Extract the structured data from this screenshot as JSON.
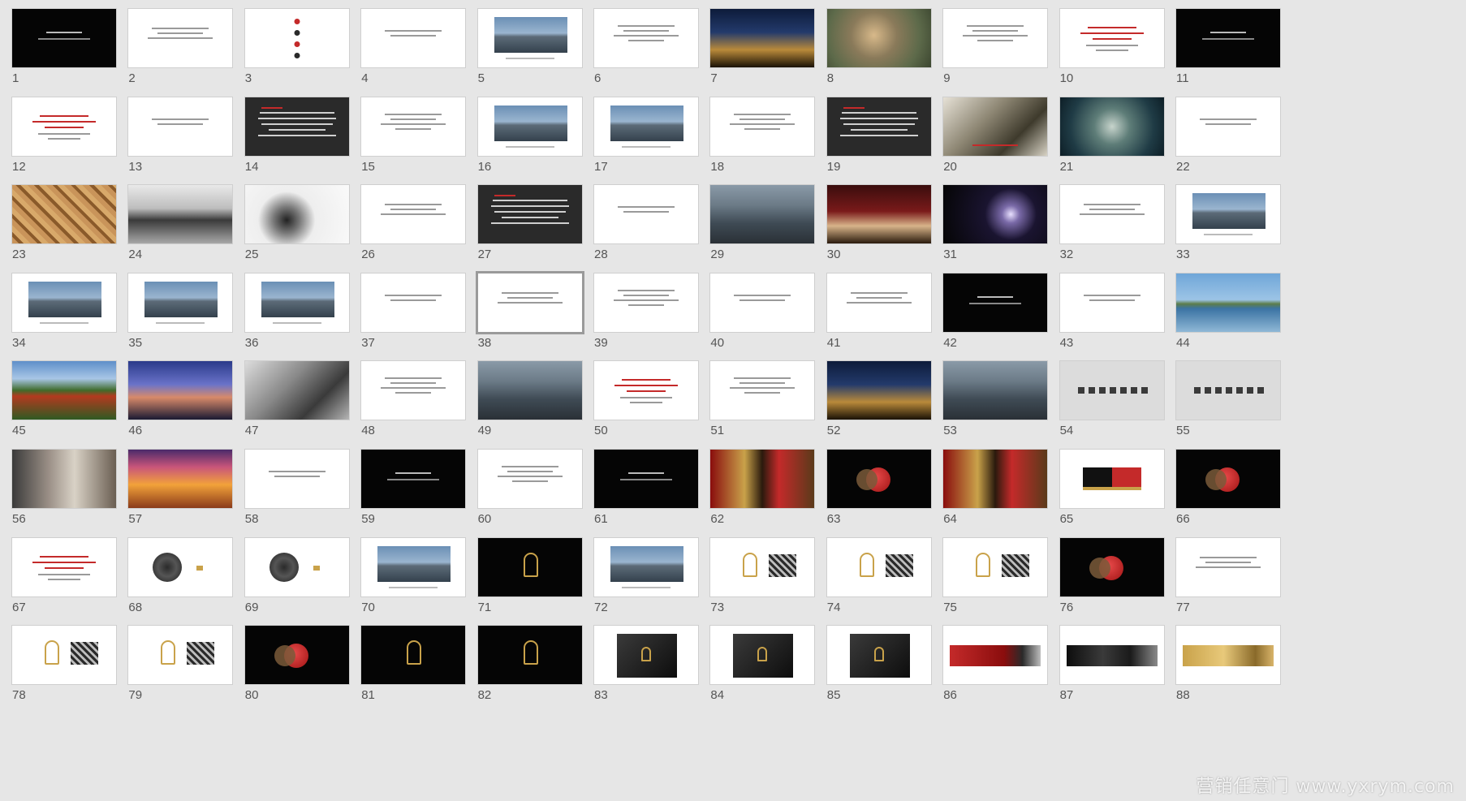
{
  "window": {
    "background": "#e6e6e6"
  },
  "slides": [
    {
      "n": "1",
      "kind": "black-text"
    },
    {
      "n": "2",
      "kind": "white-lines"
    },
    {
      "n": "3",
      "kind": "white-dots"
    },
    {
      "n": "4",
      "kind": "white-lines"
    },
    {
      "n": "5",
      "kind": "white-photo"
    },
    {
      "n": "6",
      "kind": "white-lines"
    },
    {
      "n": "7",
      "kind": "photo-night"
    },
    {
      "n": "8",
      "kind": "photo-portrait"
    },
    {
      "n": "9",
      "kind": "white-lines"
    },
    {
      "n": "10",
      "kind": "white-red"
    },
    {
      "n": "11",
      "kind": "black-text"
    },
    {
      "n": "12",
      "kind": "white-red"
    },
    {
      "n": "13",
      "kind": "white-lines"
    },
    {
      "n": "14",
      "kind": "dark-text"
    },
    {
      "n": "15",
      "kind": "white-lines"
    },
    {
      "n": "16",
      "kind": "white-photo"
    },
    {
      "n": "17",
      "kind": "white-photo"
    },
    {
      "n": "18",
      "kind": "white-lines"
    },
    {
      "n": "19",
      "kind": "dark-text"
    },
    {
      "n": "20",
      "kind": "photo-bronze"
    },
    {
      "n": "21",
      "kind": "photo-teal"
    },
    {
      "n": "22",
      "kind": "white-lines"
    },
    {
      "n": "23",
      "kind": "photo-pattern"
    },
    {
      "n": "24",
      "kind": "photo-bells"
    },
    {
      "n": "25",
      "kind": "photo-ink"
    },
    {
      "n": "26",
      "kind": "white-lines"
    },
    {
      "n": "27",
      "kind": "dark-text"
    },
    {
      "n": "28",
      "kind": "white-lines"
    },
    {
      "n": "29",
      "kind": "photo-city"
    },
    {
      "n": "30",
      "kind": "photo-stage"
    },
    {
      "n": "31",
      "kind": "photo-dark"
    },
    {
      "n": "32",
      "kind": "white-lines"
    },
    {
      "n": "33",
      "kind": "white-photo"
    },
    {
      "n": "34",
      "kind": "white-photo"
    },
    {
      "n": "35",
      "kind": "white-photo"
    },
    {
      "n": "36",
      "kind": "white-photo"
    },
    {
      "n": "37",
      "kind": "white-lines"
    },
    {
      "n": "38",
      "kind": "white-lines",
      "selected": true
    },
    {
      "n": "39",
      "kind": "white-lines"
    },
    {
      "n": "40",
      "kind": "white-lines"
    },
    {
      "n": "41",
      "kind": "white-lines"
    },
    {
      "n": "42",
      "kind": "black-text"
    },
    {
      "n": "43",
      "kind": "white-lines"
    },
    {
      "n": "44",
      "kind": "photo-lake"
    },
    {
      "n": "45",
      "kind": "photo-wall"
    },
    {
      "n": "46",
      "kind": "photo-dusk"
    },
    {
      "n": "47",
      "kind": "photo-grey"
    },
    {
      "n": "48",
      "kind": "white-lines"
    },
    {
      "n": "49",
      "kind": "photo-city"
    },
    {
      "n": "50",
      "kind": "white-red"
    },
    {
      "n": "51",
      "kind": "white-lines"
    },
    {
      "n": "52",
      "kind": "photo-night"
    },
    {
      "n": "53",
      "kind": "photo-city"
    },
    {
      "n": "54",
      "kind": "grey-icons"
    },
    {
      "n": "55",
      "kind": "grey-icons"
    },
    {
      "n": "56",
      "kind": "photo-interior"
    },
    {
      "n": "57",
      "kind": "photo-sunset"
    },
    {
      "n": "58",
      "kind": "white-lines"
    },
    {
      "n": "59",
      "kind": "black-text"
    },
    {
      "n": "60",
      "kind": "white-lines"
    },
    {
      "n": "61",
      "kind": "black-text"
    },
    {
      "n": "62",
      "kind": "red-collage"
    },
    {
      "n": "63",
      "kind": "black-red"
    },
    {
      "n": "64",
      "kind": "red-collage"
    },
    {
      "n": "65",
      "kind": "white-band"
    },
    {
      "n": "66",
      "kind": "black-red"
    },
    {
      "n": "67",
      "kind": "white-red"
    },
    {
      "n": "68",
      "kind": "white-disc"
    },
    {
      "n": "69",
      "kind": "white-disc"
    },
    {
      "n": "70",
      "kind": "white-photo"
    },
    {
      "n": "71",
      "kind": "black-gold"
    },
    {
      "n": "72",
      "kind": "white-photo"
    },
    {
      "n": "73",
      "kind": "white-gold"
    },
    {
      "n": "74",
      "kind": "white-gold"
    },
    {
      "n": "75",
      "kind": "white-gold"
    },
    {
      "n": "76",
      "kind": "black-red"
    },
    {
      "n": "77",
      "kind": "white-lines"
    },
    {
      "n": "78",
      "kind": "white-gold"
    },
    {
      "n": "79",
      "kind": "white-gold"
    },
    {
      "n": "80",
      "kind": "black-red"
    },
    {
      "n": "81",
      "kind": "black-gold"
    },
    {
      "n": "82",
      "kind": "black-gold"
    },
    {
      "n": "83",
      "kind": "white-card"
    },
    {
      "n": "84",
      "kind": "white-card"
    },
    {
      "n": "85",
      "kind": "white-card"
    },
    {
      "n": "86",
      "kind": "white-redband"
    },
    {
      "n": "87",
      "kind": "white-darkband"
    },
    {
      "n": "88",
      "kind": "white-goldband"
    }
  ],
  "watermark": "营销任意门 www.yxrym.com",
  "colors": {
    "red": "#c42a2a",
    "gold": "#c9a24a",
    "dark": "#2a2a2a",
    "black": "#050505"
  }
}
